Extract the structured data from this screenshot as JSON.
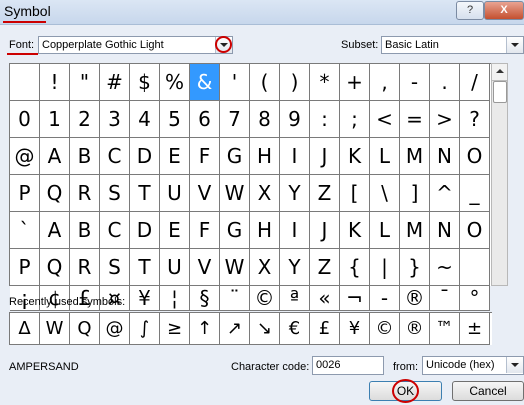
{
  "window": {
    "title": "Symbol",
    "help_label": "?",
    "close_label": "X"
  },
  "font_row": {
    "label": "Font:",
    "value": "Copperplate Gothic Light"
  },
  "subset_row": {
    "label": "Subset:",
    "value": "Basic Latin"
  },
  "grid": {
    "rows": [
      [
        " ",
        "!",
        "\"",
        "#",
        "$",
        "%",
        "&",
        "'",
        "(",
        ")",
        "*",
        "+",
        ",",
        "-",
        ".",
        "/"
      ],
      [
        "0",
        "1",
        "2",
        "3",
        "4",
        "5",
        "6",
        "7",
        "8",
        "9",
        ":",
        ";",
        "<",
        "=",
        ">",
        "?"
      ],
      [
        "@",
        "A",
        "B",
        "C",
        "D",
        "E",
        "F",
        "G",
        "H",
        "I",
        "J",
        "K",
        "L",
        "M",
        "N",
        "O"
      ],
      [
        "P",
        "Q",
        "R",
        "S",
        "T",
        "U",
        "V",
        "W",
        "X",
        "Y",
        "Z",
        "[",
        "\\",
        "]",
        "^",
        "_"
      ],
      [
        "`",
        "A",
        "B",
        "C",
        "D",
        "E",
        "F",
        "G",
        "H",
        "I",
        "J",
        "K",
        "L",
        "M",
        "N",
        "O"
      ],
      [
        "P",
        "Q",
        "R",
        "S",
        "T",
        "U",
        "V",
        "W",
        "X",
        "Y",
        "Z",
        "{",
        "|",
        "}",
        "~",
        " "
      ],
      [
        "¡",
        "¢",
        "£",
        "¤",
        "¥",
        "¦",
        "§",
        "¨",
        "©",
        "ª",
        "«",
        "¬",
        "-",
        "®",
        "¯",
        "°"
      ]
    ],
    "selected_symbol": "&"
  },
  "recent": {
    "label": "Recently used symbols:",
    "symbols": [
      "Δ",
      "W",
      "Q",
      "@",
      "∫",
      "≥",
      "↑",
      "↗",
      "↘",
      "€",
      "£",
      "¥",
      "©",
      "®",
      "™",
      "±"
    ]
  },
  "selected_name": "AMPERSAND",
  "char_code": {
    "label": "Character code:",
    "value": "0026"
  },
  "from": {
    "label": "from:",
    "value": "Unicode (hex)"
  },
  "buttons": {
    "ok": "OK",
    "cancel": "Cancel"
  },
  "colors": {
    "selection": "#3399ff",
    "annotation_red": "#cc0000"
  }
}
